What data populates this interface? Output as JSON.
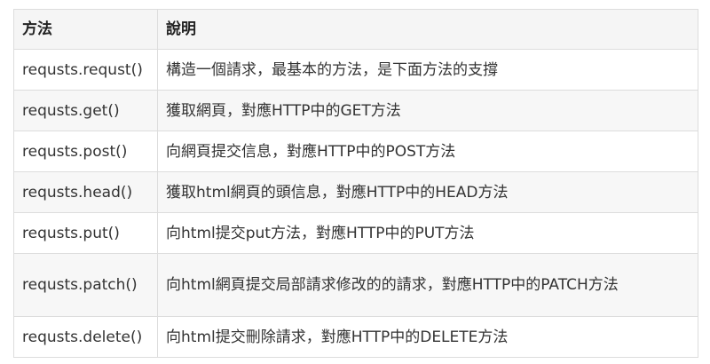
{
  "table": {
    "headers": [
      "方法",
      "說明"
    ],
    "rows": [
      {
        "method": "requsts.requst()",
        "desc": "構造一個請求，最基本的方法，是下面方法的支撐"
      },
      {
        "method": "requsts.get()",
        "desc": "獲取網頁，對應HTTP中的GET方法"
      },
      {
        "method": "requsts.post()",
        "desc": "向網頁提交信息，對應HTTP中的POST方法"
      },
      {
        "method": "requsts.head()",
        "desc": "獲取html網頁的頭信息，對應HTTP中的HEAD方法"
      },
      {
        "method": "requsts.put()",
        "desc": "向html提交put方法，對應HTTP中的PUT方法"
      },
      {
        "method": "requsts.patch()",
        "desc": "向html網頁提交局部請求修改的的請求，對應HTTP中的PATCH方法"
      },
      {
        "method": "requsts.delete()",
        "desc": "向html提交刪除請求，對應HTTP中的DELETE方法"
      }
    ]
  },
  "colors": {
    "border": "#dddddd",
    "header_bg": "#f5f5f5",
    "alt_row_bg": "#f7f7f7",
    "text": "#333333"
  }
}
